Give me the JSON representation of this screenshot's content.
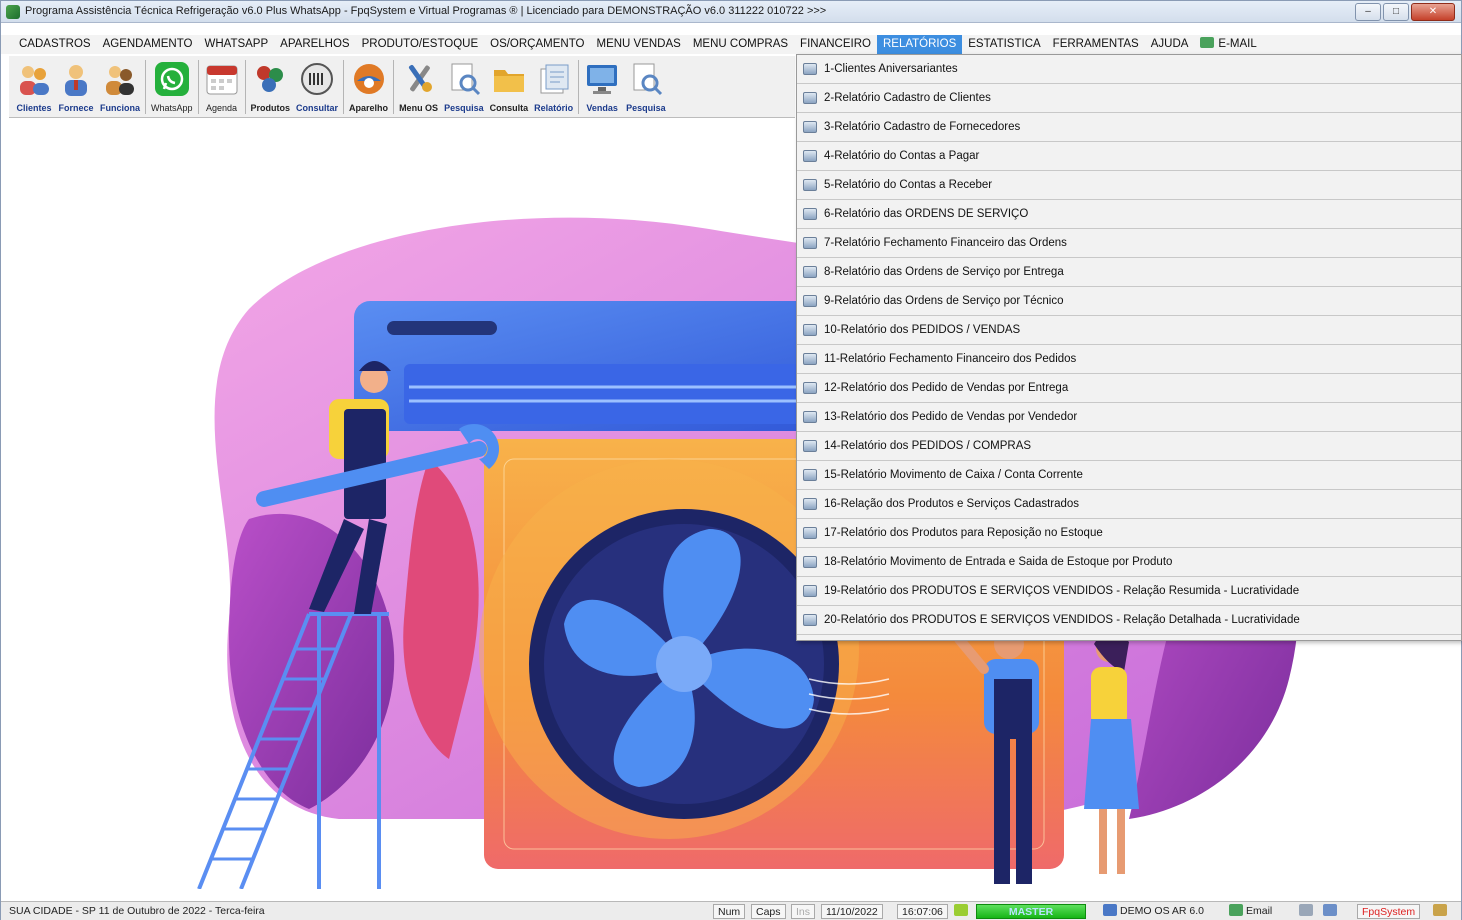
{
  "window": {
    "title": "Programa Assistência Técnica Refrigeração v6.0 Plus WhatsApp - FpqSystem e Virtual Programas ® | Licenciado para  DEMONSTRAÇÃO v6.0 311222 010722 >>>"
  },
  "menubar": {
    "items": [
      {
        "label": "CADASTROS"
      },
      {
        "label": "AGENDAMENTO"
      },
      {
        "label": "WHATSAPP"
      },
      {
        "label": "APARELHOS"
      },
      {
        "label": "PRODUTO/ESTOQUE"
      },
      {
        "label": "OS/ORÇAMENTO"
      },
      {
        "label": "MENU VENDAS"
      },
      {
        "label": "MENU COMPRAS"
      },
      {
        "label": "FINANCEIRO"
      },
      {
        "label": "RELATÓRIOS"
      },
      {
        "label": "ESTATISTICA"
      },
      {
        "label": "FERRAMENTAS"
      },
      {
        "label": "AJUDA"
      },
      {
        "label": "E-MAIL"
      }
    ]
  },
  "toolbar": {
    "buttons": [
      {
        "label": "Clientes",
        "icon": "clients-icon",
        "color": "#e8a23a"
      },
      {
        "label": "Fornece",
        "icon": "supplier-icon",
        "color": "#4a78c6"
      },
      {
        "label": "Funciona",
        "icon": "employee-icon",
        "color": "#d08a3a"
      },
      {
        "label": "WhatsApp",
        "icon": "whatsapp-icon",
        "color": "#25b03c"
      },
      {
        "label": "Agenda",
        "icon": "calendar-icon",
        "color": "#c8382e"
      },
      {
        "label": "Produtos",
        "icon": "products-icon",
        "color": "#c0392b"
      },
      {
        "label": "Consultar",
        "icon": "barcode-icon",
        "color": "#555555"
      },
      {
        "label": "Aparelho",
        "icon": "device-icon",
        "color": "#e07a26"
      },
      {
        "label": "Menu OS",
        "icon": "tools-icon",
        "color": "#3a6fb8"
      },
      {
        "label": "Pesquisa",
        "icon": "search-doc-icon",
        "color": "#5a86c2"
      },
      {
        "label": "Consulta",
        "icon": "folder-icon",
        "color": "#e2a52c"
      },
      {
        "label": "Relatório",
        "icon": "report-icon",
        "color": "#7a9cc8"
      },
      {
        "label": "Vendas",
        "icon": "monitor-icon",
        "color": "#2f6fbf"
      },
      {
        "label": "Pesquisa",
        "icon": "search-doc-icon",
        "color": "#5a86c2"
      }
    ]
  },
  "relatorios_menu": {
    "items": [
      {
        "label": "1-Clientes Aniversariantes"
      },
      {
        "label": "2-Relatório Cadastro de Clientes"
      },
      {
        "label": "3-Relatório Cadastro de Fornecedores"
      },
      {
        "label": "4-Relatório do Contas a Pagar"
      },
      {
        "label": "5-Relatório do Contas a Receber"
      },
      {
        "label": "6-Relatório das ORDENS DE SERVIÇO"
      },
      {
        "label": "7-Relatório Fechamento Financeiro das Ordens"
      },
      {
        "label": "8-Relatório das Ordens de Serviço por Entrega"
      },
      {
        "label": "9-Relatório das Ordens de Serviço por Técnico"
      },
      {
        "label": "10-Relatório dos PEDIDOS / VENDAS"
      },
      {
        "label": "11-Relatório Fechamento Financeiro dos Pedidos"
      },
      {
        "label": "12-Relatório dos Pedido de Vendas por Entrega"
      },
      {
        "label": "13-Relatório dos Pedido de Vendas por Vendedor"
      },
      {
        "label": "14-Relatório dos PEDIDOS / COMPRAS"
      },
      {
        "label": "15-Relatório Movimento de Caixa / Conta Corrente"
      },
      {
        "label": "16-Relação dos Produtos e Serviços Cadastrados"
      },
      {
        "label": "17-Relatório dos Produtos para Reposição no Estoque"
      },
      {
        "label": "18-Relatório Movimento de Entrada e Saida de Estoque por Produto"
      },
      {
        "label": "19-Relatório dos PRODUTOS E SERVIÇOS VENDIDOS - Relação Resumida - Lucratividade"
      },
      {
        "label": "20-Relatório dos PRODUTOS E SERVIÇOS VENDIDOS - Relação Detalhada - Lucratividade"
      }
    ]
  },
  "statusbar": {
    "location": "SUA CIDADE - SP 11 de Outubro de 2022 - Terca-feira",
    "num": "Num",
    "caps": "Caps",
    "ins": "Ins",
    "date": "11/10/2022",
    "time": "16:07:06",
    "user": "MASTER",
    "database": "DEMO OS AR 6.0",
    "email": "Email",
    "brand": "FpqSystem"
  },
  "colors": {
    "menu_active": "#3d8ee0",
    "master_badge": "#17b517",
    "brand_text": "#dd2222"
  }
}
